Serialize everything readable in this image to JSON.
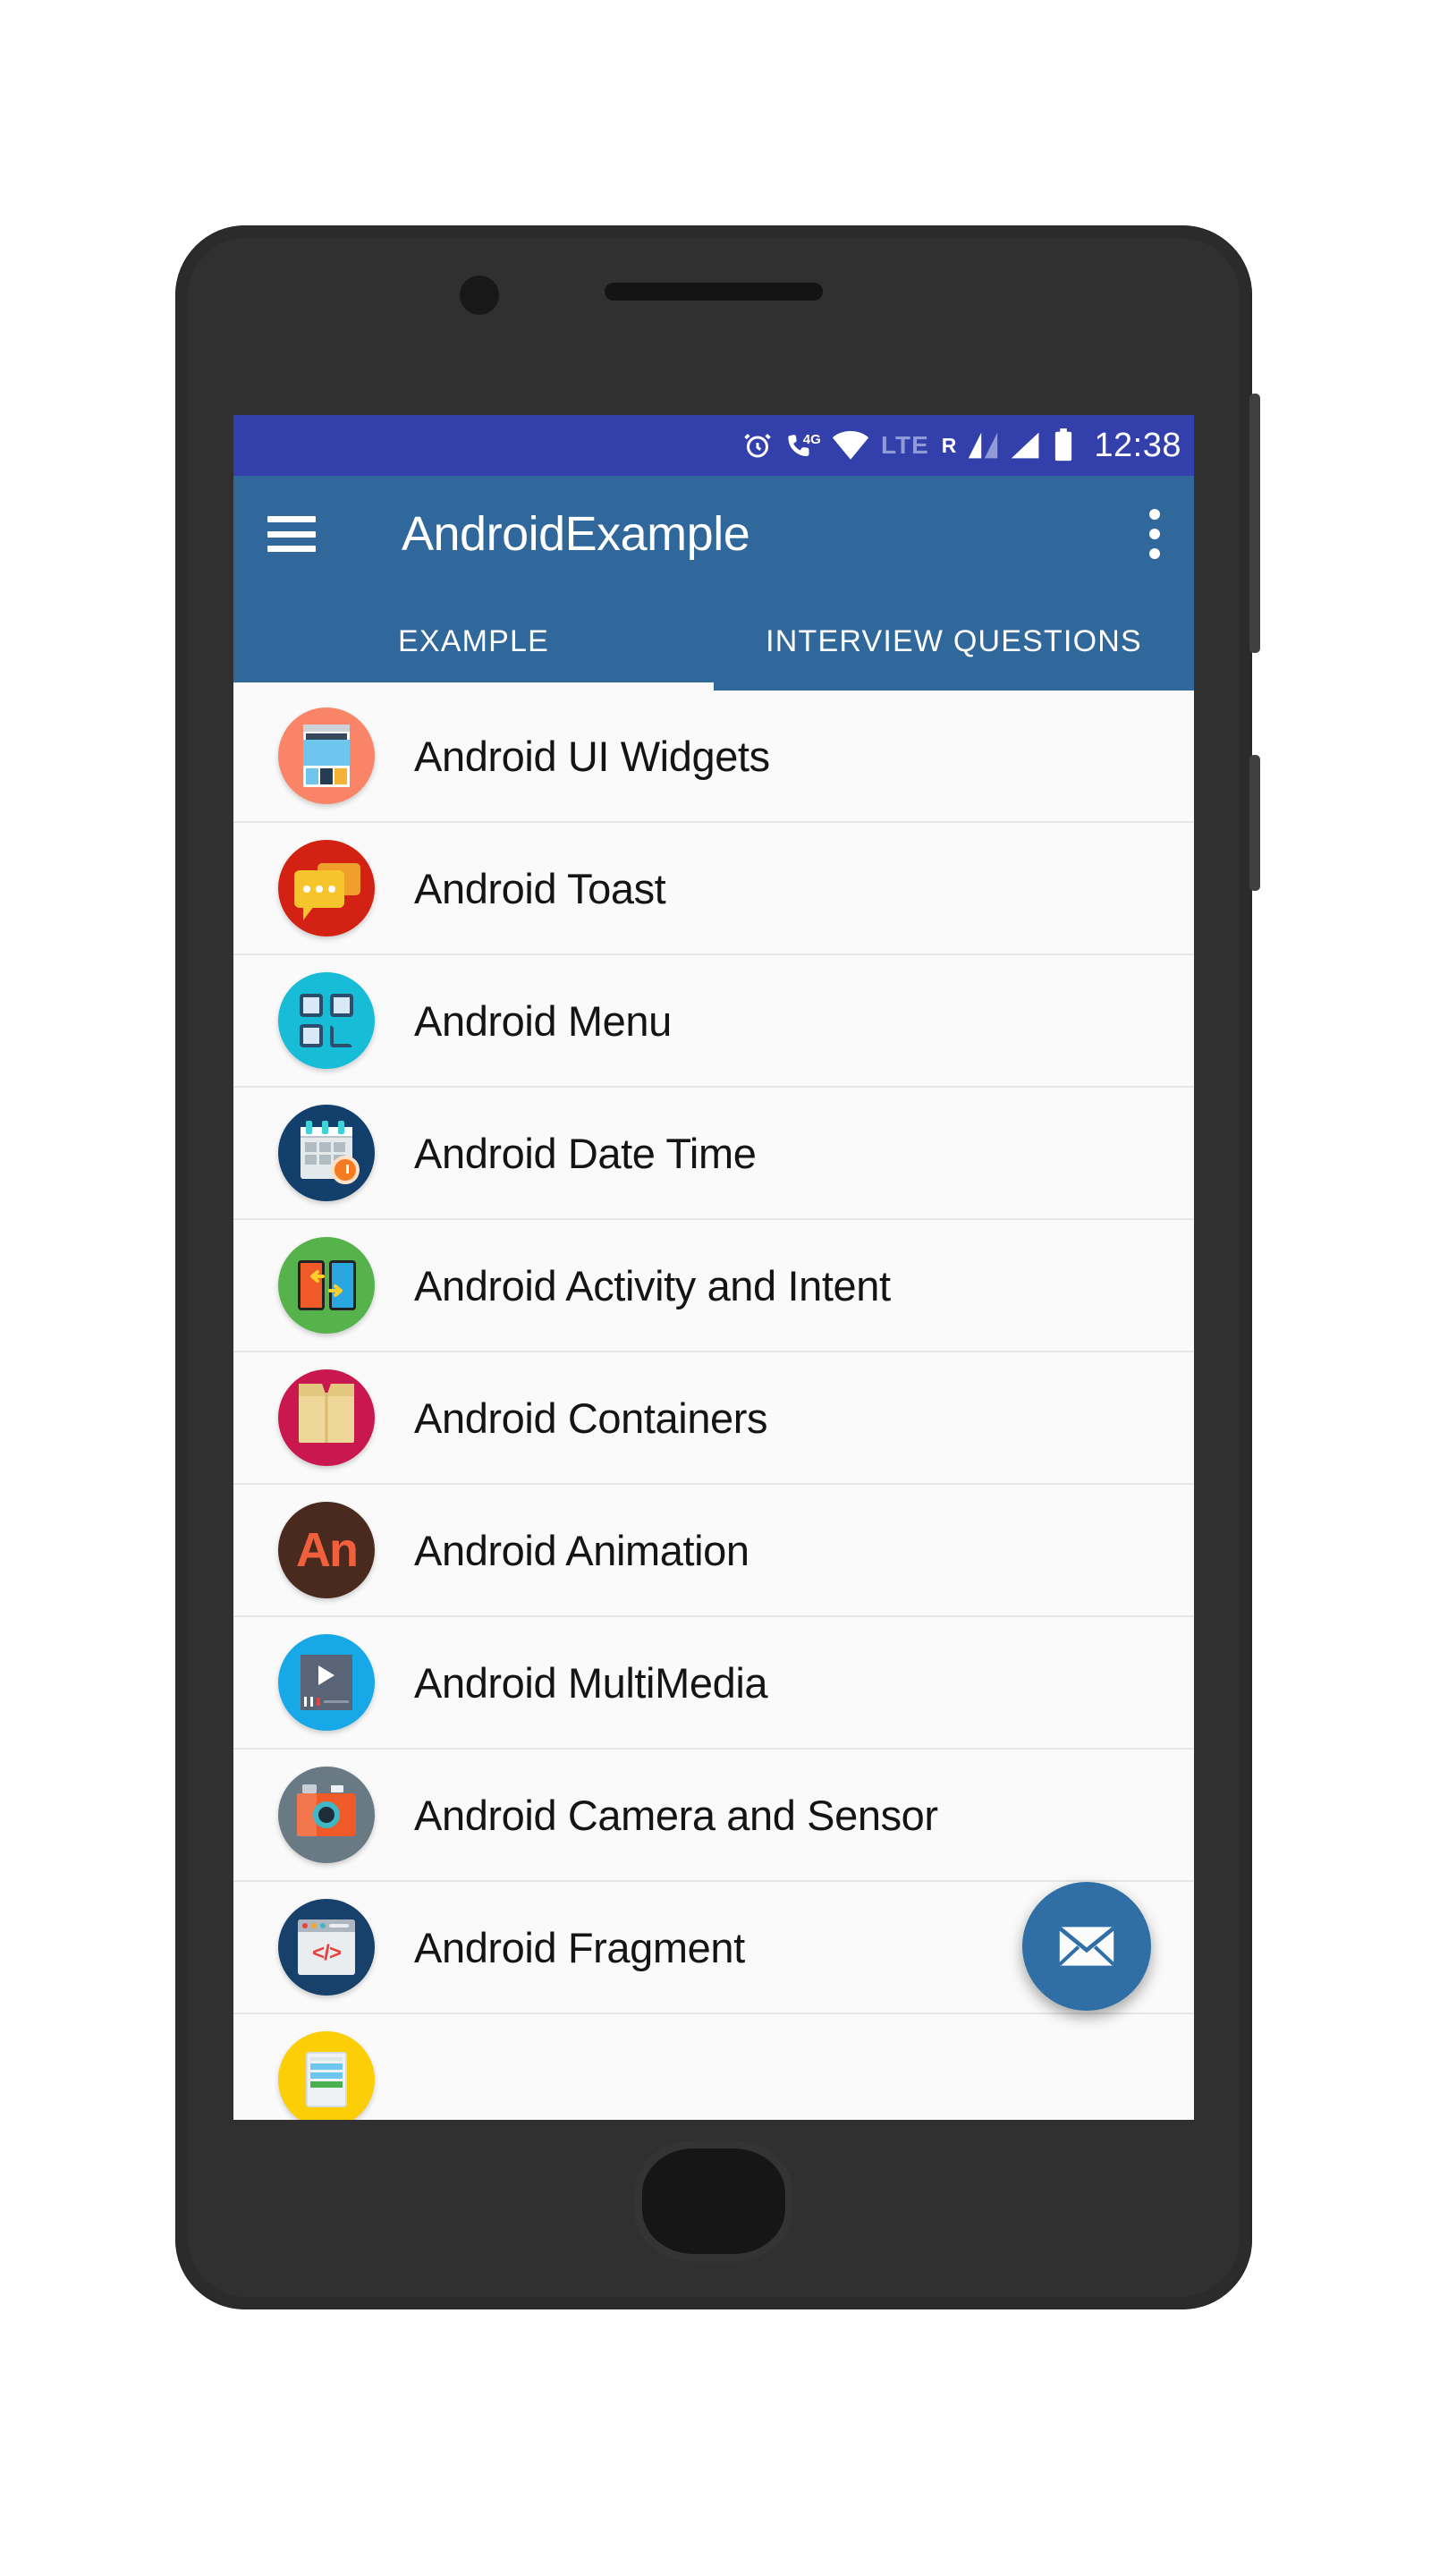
{
  "device": {
    "type": "android-phone-mockup",
    "body_color": "#2b2b2b"
  },
  "status_bar": {
    "background": "#3340AC",
    "time": "12:38",
    "network_label": "4G",
    "lte_label": "LTE",
    "roaming_label": "R",
    "icons": [
      "alarm-icon",
      "phone-4g-icon",
      "wifi-icon",
      "lte-label",
      "roaming-label",
      "signal-bars-icon-1",
      "signal-bars-icon-2",
      "battery-icon"
    ]
  },
  "app_bar": {
    "background": "#31689B",
    "title": "AndroidExample",
    "menu_icon": "hamburger-icon",
    "overflow_icon": "overflow-menu-icon"
  },
  "tabs": {
    "background": "#31689B",
    "indicator_color": "#FAFAFA",
    "selected_index": 0,
    "items": [
      {
        "label": "EXAMPLE"
      },
      {
        "label": "INTERVIEW QUESTIONS"
      }
    ]
  },
  "list": {
    "background": "#FAFAFA",
    "items": [
      {
        "label": "Android UI Widgets",
        "icon": "ui-widgets-icon",
        "color": "#F98468"
      },
      {
        "label": "Android Toast",
        "icon": "toast-message-icon",
        "color": "#D32213"
      },
      {
        "label": "Android Menu",
        "icon": "menu-grid-icon",
        "color": "#17BDD6"
      },
      {
        "label": "Android Date Time",
        "icon": "calendar-clock-icon",
        "color": "#123F6B"
      },
      {
        "label": "Android Activity and Intent",
        "icon": "activity-intent-icon",
        "color": "#56B34B"
      },
      {
        "label": "Android Containers",
        "icon": "container-box-icon",
        "color": "#C9174F"
      },
      {
        "label": "Android Animation",
        "icon": "animation-an-icon",
        "color": "#4A2A1E"
      },
      {
        "label": "Android MultiMedia",
        "icon": "multimedia-player-icon",
        "color": "#17A8E8"
      },
      {
        "label": "Android Camera and Sensor",
        "icon": "camera-sensor-icon",
        "color": "#6A7A85"
      },
      {
        "label": "Android Fragment",
        "icon": "code-fragment-icon",
        "color": "#17406B"
      },
      {
        "label": "",
        "icon": "device-widget-icon",
        "color": "#FBCE06"
      }
    ]
  },
  "fab": {
    "icon": "email-envelope-icon",
    "color": "#2F6FA5"
  }
}
